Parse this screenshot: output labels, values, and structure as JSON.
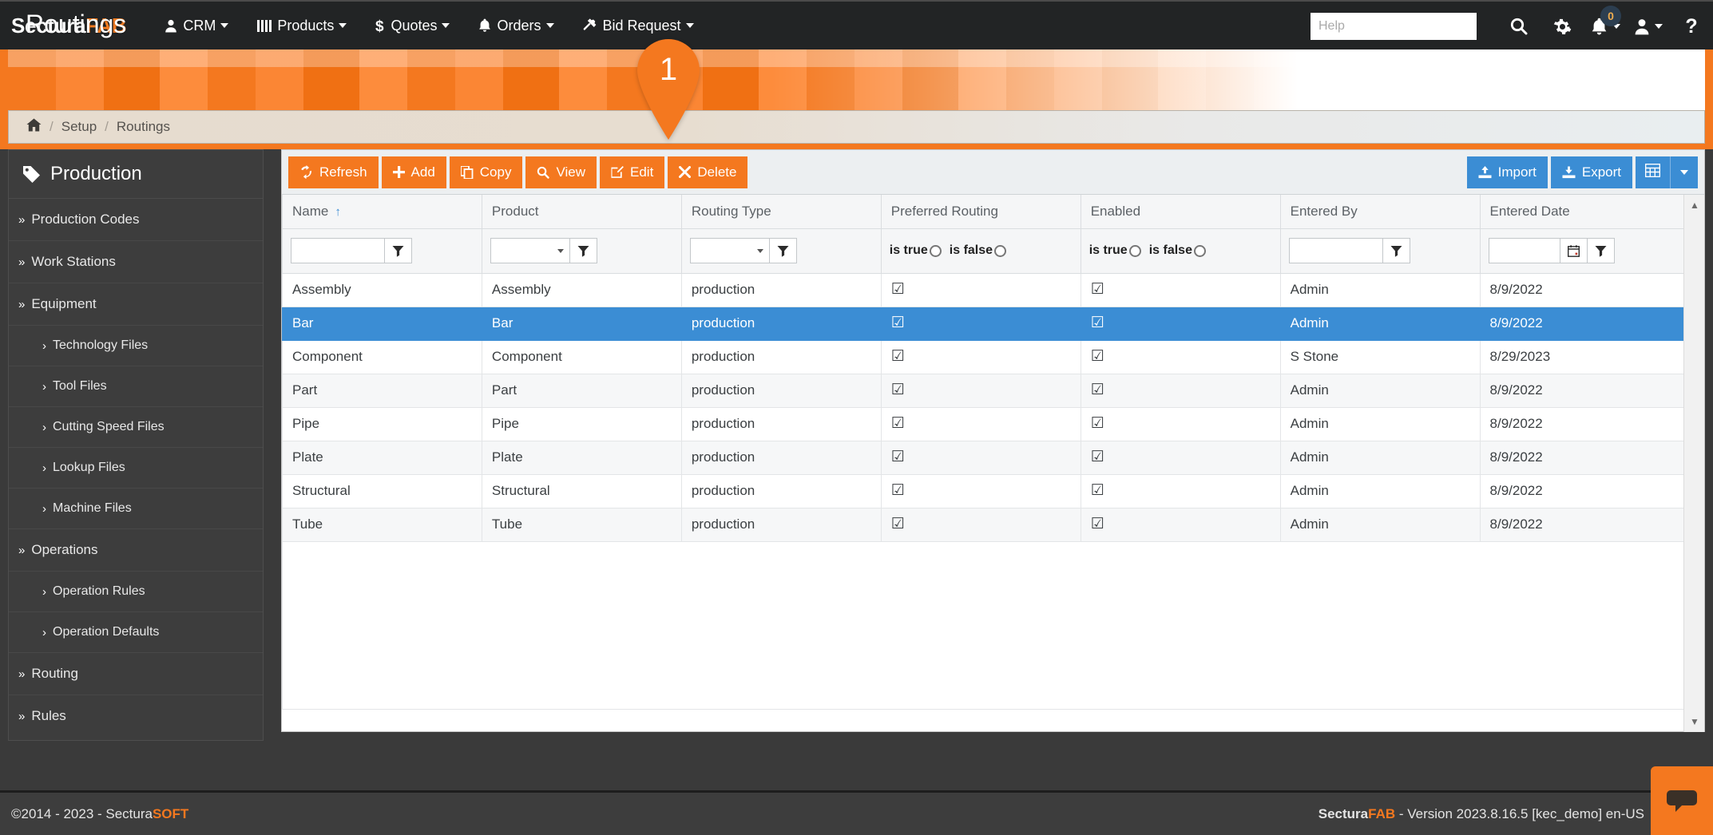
{
  "brand": {
    "first": "Sectura",
    "second": "FAB"
  },
  "topnav": {
    "items": [
      {
        "label": "CRM",
        "icon": "user-icon"
      },
      {
        "label": "Products",
        "icon": "bars-icon"
      },
      {
        "label": "Quotes",
        "icon": "dollar-icon"
      },
      {
        "label": "Orders",
        "icon": "bell-icon"
      },
      {
        "label": "Bid Request",
        "icon": "hammer-icon"
      }
    ],
    "help_placeholder": "Help",
    "help_value": "",
    "notification_count": "0"
  },
  "banner": {
    "title": "Routings",
    "marker_number": "1"
  },
  "breadcrumb": {
    "home": "⌂",
    "items": [
      "Setup",
      "Routings"
    ],
    "separator": "/"
  },
  "sidebar": {
    "header": "Production",
    "items": [
      {
        "label": "Production Codes",
        "level": 1
      },
      {
        "label": "Work Stations",
        "level": 1
      },
      {
        "label": "Equipment",
        "level": 1
      },
      {
        "label": "Technology Files",
        "level": 2
      },
      {
        "label": "Tool Files",
        "level": 2
      },
      {
        "label": "Cutting Speed Files",
        "level": 2
      },
      {
        "label": "Lookup Files",
        "level": 2
      },
      {
        "label": "Machine Files",
        "level": 2
      },
      {
        "label": "Operations",
        "level": 1
      },
      {
        "label": "Operation Rules",
        "level": 2
      },
      {
        "label": "Operation Defaults",
        "level": 2
      },
      {
        "label": "Routing",
        "level": 1
      },
      {
        "label": "Rules",
        "level": 1
      }
    ]
  },
  "toolbar": {
    "refresh": "Refresh",
    "add": "Add",
    "copy": "Copy",
    "view": "View",
    "edit": "Edit",
    "delete": "Delete",
    "import": "Import",
    "export": "Export"
  },
  "colors": {
    "orange": "#f4781f",
    "blue": "#3b8dd4",
    "dark": "#3d3d3d",
    "selected_row": "#3b8dd4"
  },
  "table": {
    "columns": [
      {
        "label": "Name",
        "sorted": "asc",
        "filter": "text"
      },
      {
        "label": "Product",
        "filter": "select"
      },
      {
        "label": "Routing Type",
        "filter": "select"
      },
      {
        "label": "Preferred Routing",
        "filter": "bool"
      },
      {
        "label": "Enabled",
        "filter": "bool"
      },
      {
        "label": "Entered By",
        "filter": "text"
      },
      {
        "label": "Entered Date",
        "filter": "date"
      }
    ],
    "bool_filter": {
      "is_true": "is true",
      "is_false": "is false"
    },
    "filter_values": {
      "name": "",
      "product": "",
      "routing_type": "",
      "entered_by": "",
      "entered_date": ""
    },
    "checked_glyph": "☑",
    "rows": [
      {
        "name": "Assembly",
        "product": "Assembly",
        "routing_type": "production",
        "preferred": true,
        "enabled": true,
        "entered_by": "Admin",
        "entered_date": "8/9/2022",
        "selected": false
      },
      {
        "name": "Bar",
        "product": "Bar",
        "routing_type": "production",
        "preferred": true,
        "enabled": true,
        "entered_by": "Admin",
        "entered_date": "8/9/2022",
        "selected": true
      },
      {
        "name": "Component",
        "product": "Component",
        "routing_type": "production",
        "preferred": true,
        "enabled": true,
        "entered_by": "S Stone",
        "entered_date": "8/29/2023",
        "selected": false
      },
      {
        "name": "Part",
        "product": "Part",
        "routing_type": "production",
        "preferred": true,
        "enabled": true,
        "entered_by": "Admin",
        "entered_date": "8/9/2022",
        "selected": false
      },
      {
        "name": "Pipe",
        "product": "Pipe",
        "routing_type": "production",
        "preferred": true,
        "enabled": true,
        "entered_by": "Admin",
        "entered_date": "8/9/2022",
        "selected": false
      },
      {
        "name": "Plate",
        "product": "Plate",
        "routing_type": "production",
        "preferred": true,
        "enabled": true,
        "entered_by": "Admin",
        "entered_date": "8/9/2022",
        "selected": false
      },
      {
        "name": "Structural",
        "product": "Structural",
        "routing_type": "production",
        "preferred": true,
        "enabled": true,
        "entered_by": "Admin",
        "entered_date": "8/9/2022",
        "selected": false
      },
      {
        "name": "Tube",
        "product": "Tube",
        "routing_type": "production",
        "preferred": true,
        "enabled": true,
        "entered_by": "Admin",
        "entered_date": "8/9/2022",
        "selected": false
      }
    ]
  },
  "footer": {
    "copyright_prefix": "©2014 - 2023 - Sectura",
    "copyright_suffix": "SOFT",
    "version_brand_first": "Sectura",
    "version_brand_second": "FAB",
    "version_text": " - Version 2023.8.16.5 [kec_demo] en-US"
  }
}
